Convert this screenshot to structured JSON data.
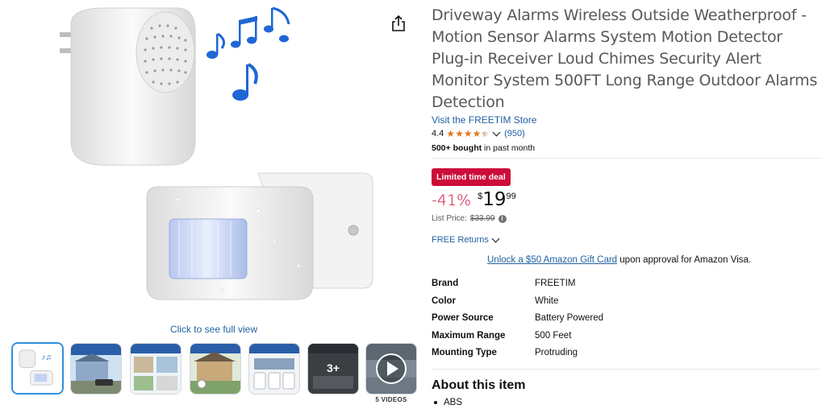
{
  "product": {
    "title": "Driveway Alarms Wireless Outside Weatherproof - Motion Sensor Alarms System Motion Detector Plug-in Receiver Loud Chimes Security Alert Monitor System 500FT Long Range Outdoor Alarms Detection",
    "store_link": "Visit the FREETIM Store",
    "rating": "4.4",
    "rating_value": 4.4,
    "rating_count": "(950)",
    "bought_bold": "500+ bought",
    "bought_rest": " in past month",
    "deal_badge": "Limited time deal",
    "discount": "-41%",
    "currency": "$",
    "price_whole": "19",
    "price_fraction": "99",
    "list_price_label": "List Price:",
    "list_price": "$33.99",
    "returns": "FREE Returns",
    "gift_link": "Unlock a $50 Amazon Gift Card",
    "gift_rest": " upon approval for Amazon Visa."
  },
  "gallery": {
    "click_full": "Click to see full view",
    "more_count": "3+",
    "videos_caption": "5 VIDEOS",
    "thumbnails": [
      "thumb-1",
      "thumb-2",
      "thumb-3",
      "thumb-4",
      "thumb-5",
      "thumb-6",
      "thumb-video"
    ]
  },
  "specs": [
    {
      "key": "Brand",
      "value": "FREETIM"
    },
    {
      "key": "Color",
      "value": "White"
    },
    {
      "key": "Power Source",
      "value": "Battery Powered"
    },
    {
      "key": "Maximum Range",
      "value": "500 Feet"
    },
    {
      "key": "Mounting Type",
      "value": "Protruding"
    }
  ],
  "about": {
    "heading": "About this item",
    "bullets": [
      "ABS"
    ]
  },
  "colors": {
    "link": "#2162a1",
    "deal": "#cc0c39",
    "star": "#de7921",
    "note_blue": "#1e66d6"
  }
}
